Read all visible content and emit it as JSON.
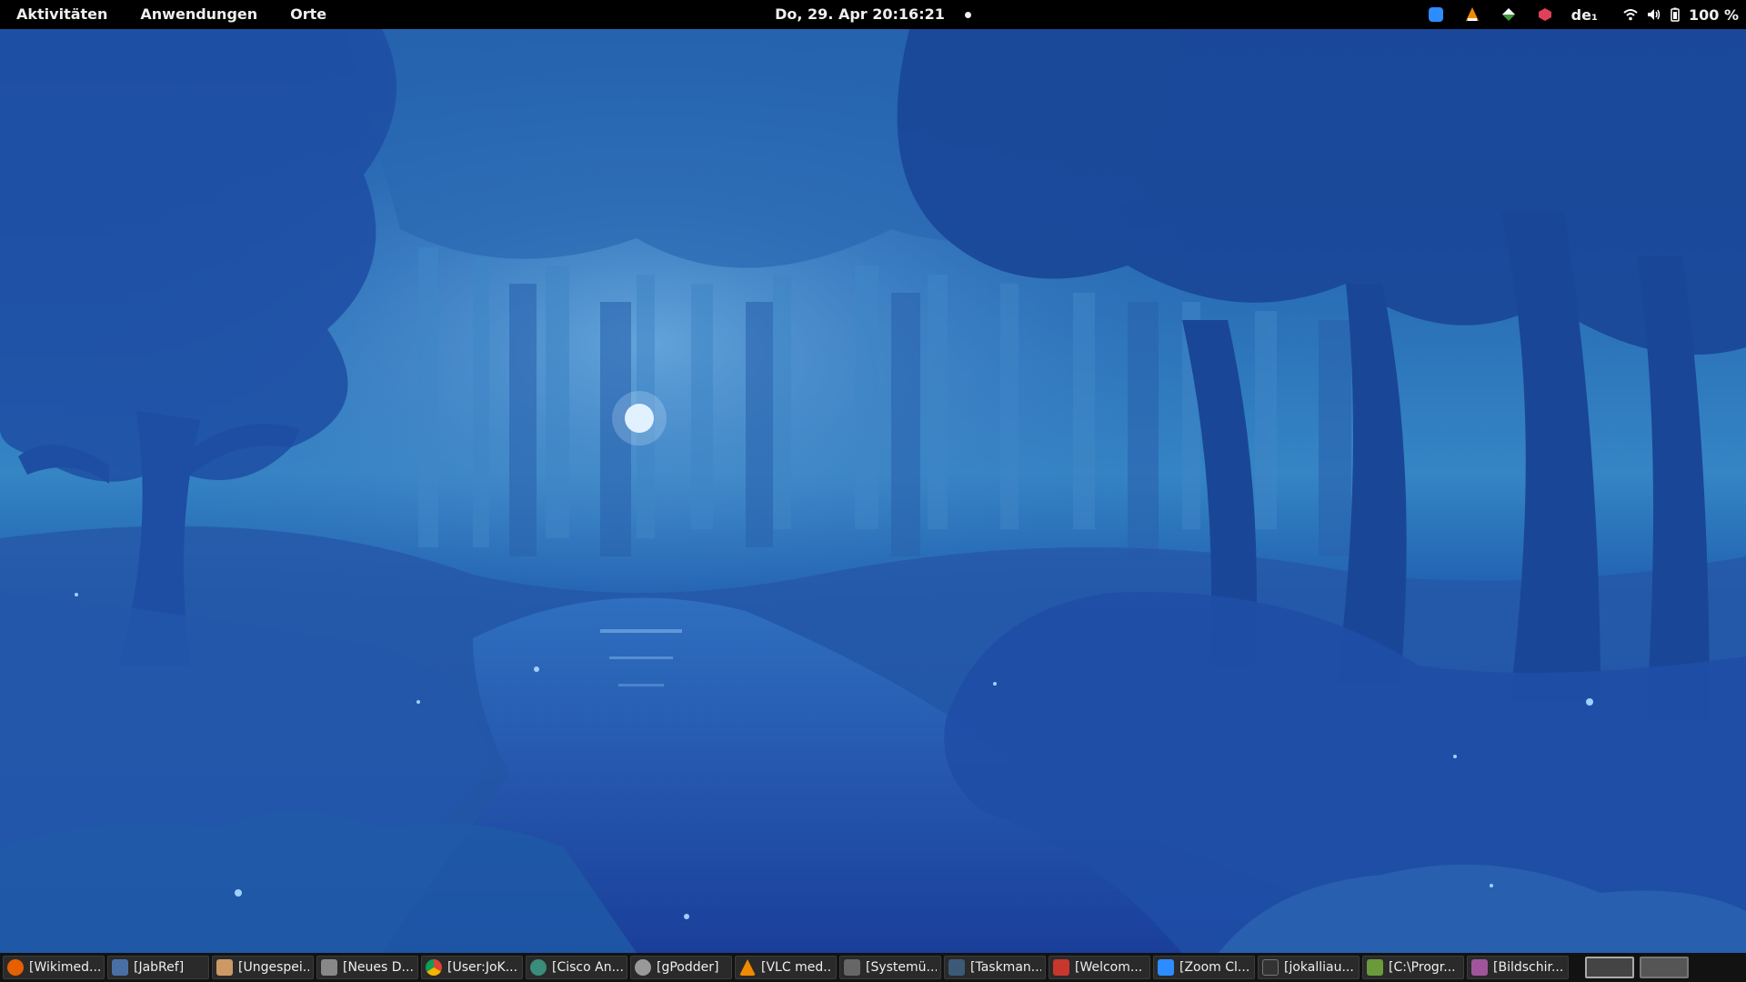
{
  "topbar": {
    "activities": "Aktivitäten",
    "applications": "Anwendungen",
    "places": "Orte",
    "clock": "Do, 29. Apr  20:16:21",
    "keyboard_layout": "de",
    "battery": "100 %",
    "tray_icons": [
      "zoom-icon",
      "vlc-icon",
      "network-sync-icon",
      "security-shield-icon"
    ]
  },
  "taskbar": {
    "items": [
      {
        "label": "[Wikimed...",
        "icon": "firefox-icon",
        "color": "#e66000"
      },
      {
        "label": "[JabRef]",
        "icon": "jabref-icon",
        "color": "#4a6fa5"
      },
      {
        "label": "[Ungespei...",
        "icon": "text-editor-icon",
        "color": "#c96"
      },
      {
        "label": "[Neues D...",
        "icon": "document-icon",
        "color": "#888"
      },
      {
        "label": "[User:JoK...",
        "icon": "chrome-icon",
        "color": "#3a9a3a"
      },
      {
        "label": "[Cisco An...",
        "icon": "globe-icon",
        "color": "#3b8c7a"
      },
      {
        "label": "[gPodder]",
        "icon": "gpodder-icon",
        "color": "#999"
      },
      {
        "label": "[VLC med...",
        "icon": "vlc-icon",
        "color": "#f08a00"
      },
      {
        "label": "[Systemü...",
        "icon": "system-monitor-icon",
        "color": "#666"
      },
      {
        "label": "[Taskman...",
        "icon": "task-manager-icon",
        "color": "#3c5a78"
      },
      {
        "label": "[Welcom...",
        "icon": "welcome-icon",
        "color": "#c8372d"
      },
      {
        "label": "[Zoom Cl...",
        "icon": "zoom-icon",
        "color": "#2d8cff"
      },
      {
        "label": "[jokalliau...",
        "icon": "terminal-icon",
        "color": "#333"
      },
      {
        "label": "[C:\\Progr...",
        "icon": "wine-icon",
        "color": "#6a9a3a"
      },
      {
        "label": "[Bildschir...",
        "icon": "screenshot-icon",
        "color": "#a0559a"
      }
    ]
  }
}
